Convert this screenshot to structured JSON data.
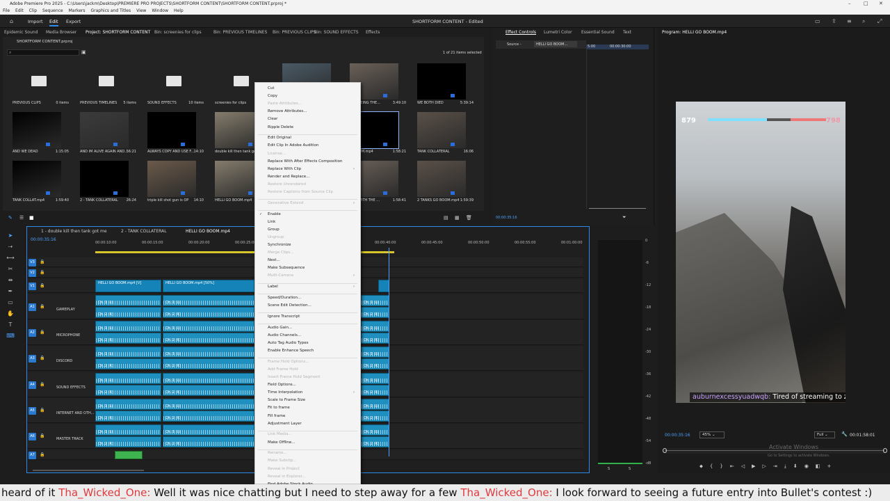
{
  "window": {
    "title": "Adobe Premiere Pro 2025 - C:\\Users\\jackm\\Desktop\\PREMIERE PRO PROJECTS\\SHORTFORM CONTENT\\SHORTFORM CONTENT.prproj *",
    "menu": [
      "File",
      "Edit",
      "Clip",
      "Sequence",
      "Markers",
      "Graphics and Titles",
      "View",
      "Window",
      "Help"
    ]
  },
  "header": {
    "tabs": [
      "Import",
      "Edit",
      "Export"
    ],
    "active_tab": "Edit",
    "project_status": "SHORTFORM CONTENT - Edited"
  },
  "project_panel": {
    "tabs": [
      "Epidemic Sound",
      "Media Browser",
      "Project: SHORTFORM CONTENT",
      "Bin: screenies for clips",
      "Bin: PREVIOUS TIMELINES",
      "Bin: PREVIOUS CLIPS",
      "Bin: SOUND EFFECTS",
      "Effects"
    ],
    "project_file": "SHORTFORM CONTENT.prproj",
    "selection_count": "1 of 21 items selected",
    "items": [
      {
        "name": "PREVIOUS CLIPS",
        "meta": "0 items",
        "kind": "folder"
      },
      {
        "name": "PREVIOUS TIMELINES",
        "meta": "5 items",
        "kind": "folder"
      },
      {
        "name": "SOUND EFFECTS",
        "meta": "10 items",
        "kind": "folder"
      },
      {
        "name": "screenies for clips",
        "meta": "",
        "kind": "folder"
      },
      {
        "name": "",
        "meta": "",
        "kind": "hidden"
      },
      {
        "name": "ME SEEING THE...",
        "meta": "3:49:10",
        "kind": "clip"
      },
      {
        "name": "WE BOTH DIED",
        "meta": "5:39:14",
        "kind": "clip"
      },
      {
        "name": "AND WE DEAD",
        "meta": "1:15:05",
        "kind": "clip"
      },
      {
        "name": "AND IM ALIVE AGAIN AND...",
        "meta": "56:21",
        "kind": "clip"
      },
      {
        "name": "ALWAYS COPY AND USE F...",
        "meta": "14:10",
        "kind": "clip"
      },
      {
        "name": "double kill then tank got",
        "meta": "",
        "kind": "clip"
      },
      {
        "name": "",
        "meta": "",
        "kind": "hidden"
      },
      {
        "name": "O BOOM.mp4",
        "meta": "1:58:21",
        "kind": "clip"
      },
      {
        "name": "TANK COLLATERAL",
        "meta": "16:06",
        "kind": "clip"
      },
      {
        "name": "TANK COLLAT.mp4",
        "meta": "1:59:40",
        "kind": "clip"
      },
      {
        "name": "2 - TANK COLLATERAL",
        "meta": "26:24",
        "kind": "clip"
      },
      {
        "name": "triple kill shot gun is OP",
        "meta": "14:10",
        "kind": "clip"
      },
      {
        "name": "HELLI GO BOOM.mp4",
        "meta": "",
        "kind": "clip"
      },
      {
        "name": "",
        "meta": "",
        "kind": "hidden"
      },
      {
        "name": "KILL WITH THE ...",
        "meta": "1:58:41",
        "kind": "clip"
      },
      {
        "name": "2 TANKS GO BOOM.mp4",
        "meta": "1:59:39",
        "kind": "clip"
      }
    ]
  },
  "effects_panel": {
    "tabs": [
      "Effect Controls",
      "Lumetri Color",
      "Essential Sound",
      "Text"
    ],
    "source_label": "Source -",
    "clip_label": "HELLI GO BOOM...",
    "ruler": [
      "5:00",
      "00:00:30:00"
    ],
    "timecode": "00:00:35:16"
  },
  "program": {
    "title": "Program: HELLI GO BOOM.mp4",
    "timecode": "00:00:35:16",
    "zoom": "45%",
    "quality": "Full",
    "duration": "00:01:58:01",
    "hud_left": "879",
    "hud_right": "798",
    "subtitle_user": "auburnexcessyuadwqb:",
    "subtitle_text": "Tired of streaming to z",
    "watermark_line1": "Activate Windows",
    "watermark_line2": "Go to Settings to activate Windows."
  },
  "timeline": {
    "seq_tabs": [
      "1 - double kill then tank got me",
      "2 - TANK COLLATERAL",
      "HELLI GO BOOM.mp4"
    ],
    "timecode": "00:00:35:16",
    "ruler": [
      "00:00:10:00",
      "00:00:15:00",
      "00:00:20:00",
      "00:00:25:00",
      "00:00:40:00",
      "00:00:45:00",
      "00:00:50:00",
      "00:00:55:00",
      "00:01:00:00"
    ],
    "video_clips": [
      "HELLI GO BOOM.mp4 [V]",
      "HELLI GO BOOM.mp4 [50%]"
    ],
    "tracks": [
      {
        "id": "V3",
        "label": ""
      },
      {
        "id": "V2",
        "label": ""
      },
      {
        "id": "V1",
        "label": ""
      },
      {
        "id": "A1",
        "label": "GAMEPLAY"
      },
      {
        "id": "A2",
        "label": "MICROPHONE"
      },
      {
        "id": "A3",
        "label": "DISCORD"
      },
      {
        "id": "A4",
        "label": "SOUND EFFECTS"
      },
      {
        "id": "A5",
        "label": "INTERNET AND OTH..."
      },
      {
        "id": "A6",
        "label": "MASTER TRACK"
      },
      {
        "id": "A7",
        "label": ""
      }
    ],
    "channel_labels": [
      "Ch. 1 (L)",
      "Ch. 2 (R)"
    ]
  },
  "audio_meter": {
    "scale": [
      "0",
      "-6",
      "-12",
      "-18",
      "-24",
      "-30",
      "-36",
      "-42",
      "-48",
      "-54",
      "-dB"
    ],
    "footer": [
      "S",
      "S"
    ]
  },
  "context_menu": {
    "items": [
      {
        "label": "Cut",
        "enabled": true
      },
      {
        "label": "Copy",
        "enabled": true
      },
      {
        "label": "Paste Attributes...",
        "enabled": false
      },
      {
        "label": "Remove Attributes...",
        "enabled": true
      },
      {
        "label": "Clear",
        "enabled": true
      },
      {
        "label": "Ripple Delete",
        "enabled": true
      },
      {
        "sep": true
      },
      {
        "label": "Edit Original",
        "enabled": true
      },
      {
        "label": "Edit Clip In Adobe Audition",
        "enabled": true
      },
      {
        "label": "License...",
        "enabled": false
      },
      {
        "label": "Replace With After Effects Composition",
        "enabled": true
      },
      {
        "label": "Replace With Clip",
        "enabled": true,
        "submenu": true
      },
      {
        "label": "Render and Replace...",
        "enabled": true
      },
      {
        "label": "Restore Unrendered",
        "enabled": false
      },
      {
        "label": "Restore Captions from Source Clip",
        "enabled": false
      },
      {
        "sep": true
      },
      {
        "label": "Generative Extend",
        "enabled": false,
        "submenu": true
      },
      {
        "sep": true
      },
      {
        "label": "Enable",
        "enabled": true,
        "checked": true
      },
      {
        "label": "Link",
        "enabled": true
      },
      {
        "label": "Group",
        "enabled": true
      },
      {
        "label": "Ungroup",
        "enabled": false
      },
      {
        "label": "Synchronize",
        "enabled": true
      },
      {
        "label": "Merge Clips...",
        "enabled": false
      },
      {
        "label": "Nest...",
        "enabled": true
      },
      {
        "label": "Make Subsequence",
        "enabled": true
      },
      {
        "label": "Multi-Camera",
        "enabled": false,
        "submenu": true
      },
      {
        "sep": true
      },
      {
        "label": "Label",
        "enabled": true,
        "submenu": true
      },
      {
        "sep": true
      },
      {
        "label": "Speed/Duration...",
        "enabled": true
      },
      {
        "label": "Scene Edit Detection...",
        "enabled": true
      },
      {
        "sep": true
      },
      {
        "label": "Ignore Transcript",
        "enabled": true
      },
      {
        "sep": true
      },
      {
        "label": "Audio Gain...",
        "enabled": true
      },
      {
        "label": "Audio Channels...",
        "enabled": true
      },
      {
        "label": "Auto Tag Audio Types",
        "enabled": true
      },
      {
        "label": "Enable Enhance Speech",
        "enabled": true
      },
      {
        "sep": true
      },
      {
        "label": "Frame Hold Options...",
        "enabled": false
      },
      {
        "label": "Add Frame Hold",
        "enabled": false
      },
      {
        "label": "Insert Frame Hold Segment",
        "enabled": false
      },
      {
        "label": "Field Options...",
        "enabled": true
      },
      {
        "label": "Time Interpolation",
        "enabled": true,
        "submenu": true
      },
      {
        "label": "Scale to Frame Size",
        "enabled": true
      },
      {
        "label": "Fit to frame",
        "enabled": true
      },
      {
        "label": "Fill frame",
        "enabled": true
      },
      {
        "label": "Adjustment Layer",
        "enabled": true
      },
      {
        "sep": true
      },
      {
        "label": "Link Media...",
        "enabled": false
      },
      {
        "label": "Make Offline...",
        "enabled": true
      },
      {
        "sep": true
      },
      {
        "label": "Rename...",
        "enabled": false
      },
      {
        "label": "Make Subclip...",
        "enabled": false
      },
      {
        "label": "Reveal in Project",
        "enabled": false
      },
      {
        "label": "Reveal in Explorer...",
        "enabled": false
      },
      {
        "label": "Find Adobe Stock Audio",
        "enabled": true
      }
    ]
  },
  "chat": {
    "prefix": "heard of it",
    "user1": "Tha_Wicked_One:",
    "msg1": "Well it was nice chatting but I need to step away for a few",
    "user2": "Tha_Wicked_One:",
    "msg2": "I look forward to seeing a future entry into Bullet's contest :)"
  },
  "colors": {
    "accent": "#2d8ceb",
    "clip": "#1f8fc0",
    "chat_user": "#e03a3e"
  }
}
